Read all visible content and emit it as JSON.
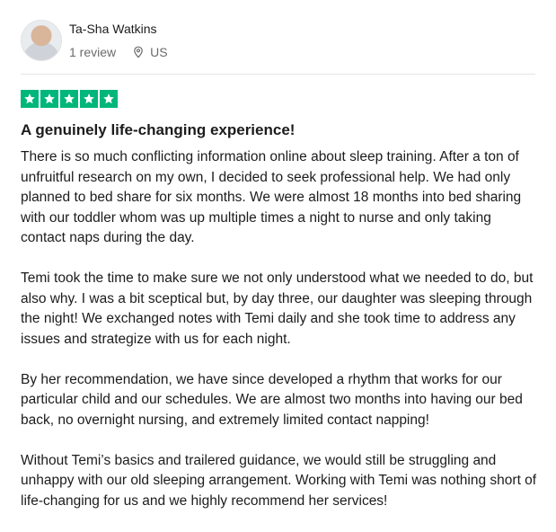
{
  "reviewer": {
    "name": "Ta-Sha Watkins",
    "review_count": "1 review",
    "country": "US"
  },
  "rating": {
    "stars": 5,
    "max": 5,
    "color": "#00b67a"
  },
  "review": {
    "title": "A genuinely life-changing experience!",
    "paragraphs": [
      "There is so much conflicting information online about sleep training. After a ton of unfruitful research on my own, I decided to seek professional help. We had only planned to bed share for six months. We were almost 18 months into bed sharing with our toddler whom was up multiple times a night to nurse and only taking contact naps during the day.",
      "Temi took the time to make sure we not only understood what we needed to do, but also why. I was a bit sceptical but, by day three, our daughter was sleeping through the night! We exchanged notes with Temi daily and she took time to address any issues and strategize with us for each night.",
      "By her recommendation, we have since developed a rhythm that works for our particular child and our schedules. We are almost two months into having our bed back, no overnight nursing, and extremely limited contact napping!",
      "Without Temi’s basics and trailered guidance, we would still be struggling and unhappy with our old sleeping arrangement. Working with Temi was nothing short of life-changing for us and we highly recommend her services!"
    ]
  },
  "icons": {
    "location": "location-pin-icon",
    "star": "star-icon"
  }
}
